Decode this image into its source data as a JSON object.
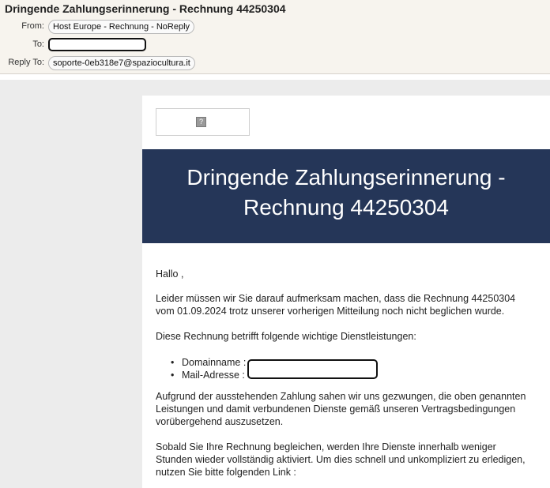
{
  "header": {
    "subject": "Dringende Zahlungserinnerung - Rechnung 44250304",
    "from_label": "From:",
    "from_value": "Host Europe - Rechnung - NoReply",
    "to_label": "To:",
    "replyto_label": "Reply To:",
    "replyto_value": "soporte-0eb318e7@spaziocultura.it"
  },
  "email": {
    "logo_icon": "broken-image-icon",
    "logo_glyph": "?",
    "banner_title_line1": "Dringende Zahlungserinnerung -",
    "banner_title_line2": "Rechnung 44250304",
    "banner_color": "#253658",
    "greeting": "Hallo ,",
    "para1": "Leider müssen wir Sie darauf aufmerksam machen, dass die Rechnung 44250304 vom 01.09.2024 trotz unserer vorherigen Mitteilung noch nicht beglichen wurde.",
    "para2": "Diese Rechnung betrifft folgende wichtige Dienstleistungen:",
    "bullet1_label": "Domainname :",
    "bullet2_label": "Mail-Adresse :",
    "para3": "Aufgrund der ausstehenden Zahlung sahen wir uns gezwungen, die oben genannten Leistungen und damit verbundenen Dienste gemäß unseren Vertragsbedingungen vorübergehend auszusetzen.",
    "para4": "Sobald Sie Ihre Rechnung begleichen, werden Ihre Dienste innerhalb weniger Stunden wieder vollständig aktiviert. Um dies schnell und unkompliziert zu erledigen, nutzen Sie bitte folgenden Link :"
  }
}
